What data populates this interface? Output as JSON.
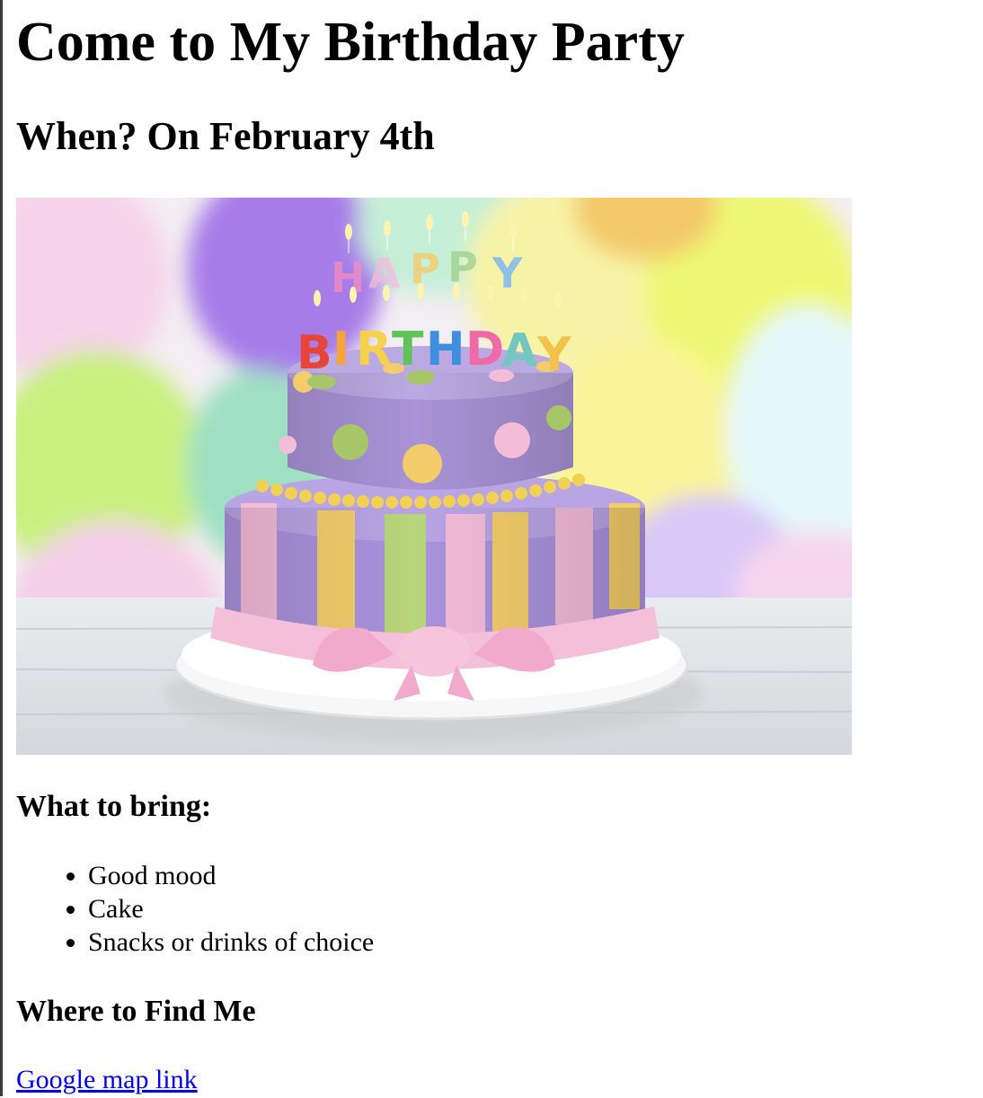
{
  "page": {
    "title": "Come to My Birthday Party",
    "when": "When? On February 4th",
    "what_to_bring": {
      "heading": "What to bring:",
      "items": [
        "Good mood",
        "Cake",
        "Snacks or drinks of choice"
      ]
    },
    "where": {
      "heading": "Where to Find Me",
      "link_text": "Google map link"
    }
  },
  "image": {
    "description_icon": "birthday-cake-image",
    "candle_letters_top": "HAPPY",
    "candle_letters_bottom": "BIRTHDAY"
  },
  "colors": {
    "link": "#0000ee",
    "cake_purple": "#a993d6",
    "cake_pink": "#f1bcd6",
    "cake_yellow": "#f4d06a",
    "cake_green": "#b7d57a"
  }
}
